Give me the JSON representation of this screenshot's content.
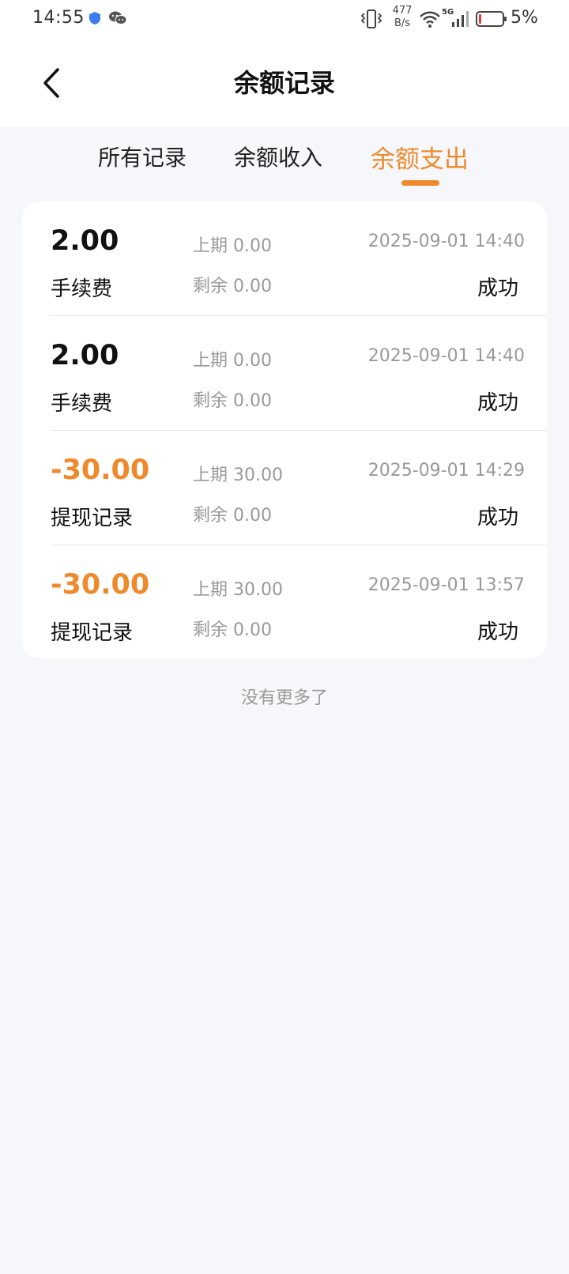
{
  "status_bar": {
    "time": "14:55",
    "net_speed_value": "477",
    "net_speed_unit": "B/s",
    "network_type": "5G",
    "battery_percent": "5%"
  },
  "header": {
    "title": "余额记录"
  },
  "tabs": [
    {
      "label": "所有记录",
      "active": false
    },
    {
      "label": "余额收入",
      "active": false
    },
    {
      "label": "余额支出",
      "active": true
    }
  ],
  "records": [
    {
      "amount": "2.00",
      "type": "手续费",
      "prev": "上期 0.00",
      "remain": "剩余 0.00",
      "datetime": "2025-09-01 14:40",
      "status": "成功"
    },
    {
      "amount": "2.00",
      "type": "手续费",
      "prev": "上期 0.00",
      "remain": "剩余 0.00",
      "datetime": "2025-09-01 14:40",
      "status": "成功"
    },
    {
      "amount": "-30.00",
      "type": "提现记录",
      "prev": "上期 30.00",
      "remain": "剩余 0.00",
      "datetime": "2025-09-01 14:29",
      "status": "成功"
    },
    {
      "amount": "-30.00",
      "type": "提现记录",
      "prev": "上期 30.00",
      "remain": "剩余 0.00",
      "datetime": "2025-09-01 13:57",
      "status": "成功"
    }
  ],
  "footer": {
    "no_more": "没有更多了"
  },
  "colors": {
    "accent": "#ee8a2c",
    "background": "#f6f7fb",
    "muted_text": "#999999"
  }
}
